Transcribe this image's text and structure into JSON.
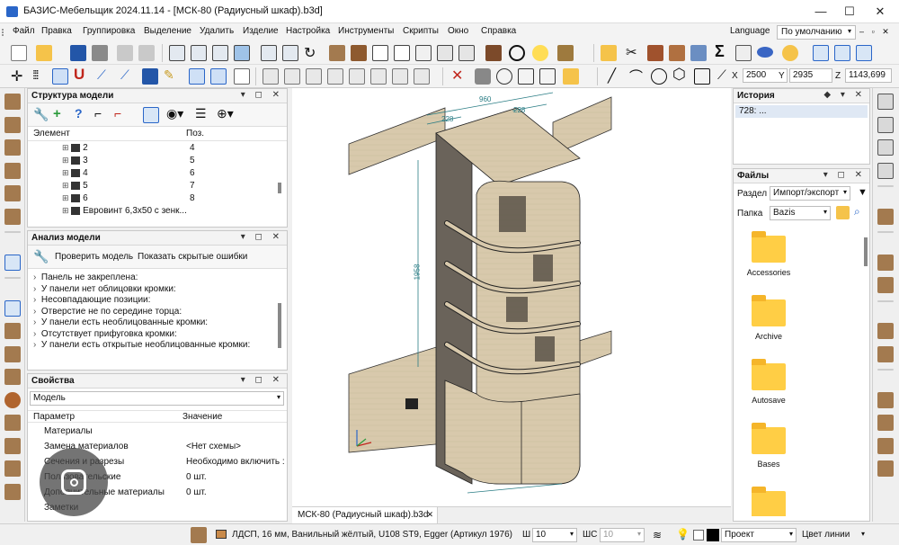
{
  "window": {
    "title": "БАЗИС-Мебельщик 2024.11.14 - [МСК-80 (Радиусный шкаф).b3d]",
    "minimize": "—",
    "maximize": "☐",
    "close": "✕"
  },
  "menu": [
    "Файл",
    "Правка",
    "Группировка",
    "Выделение",
    "Удалить",
    "Изделие",
    "Настройка",
    "Инструменты",
    "Скрипты",
    "Окно",
    "Справка"
  ],
  "menu_right": {
    "language": "Language",
    "default": "По умолчанию"
  },
  "coords": {
    "x_label": "X",
    "x": "2500",
    "y_label": "Y",
    "y": "2935",
    "z_label": "Z",
    "z": "1143,699"
  },
  "structure": {
    "title": "Структура модели",
    "col_element": "Элемент",
    "col_pos": "Поз.",
    "items": [
      {
        "name": "2",
        "pos": "4"
      },
      {
        "name": "3",
        "pos": "5"
      },
      {
        "name": "4",
        "pos": "6"
      },
      {
        "name": "5",
        "pos": "7"
      },
      {
        "name": "6",
        "pos": "8"
      },
      {
        "name": "Евровинт 6,3х50 с зенк...",
        "pos": ""
      }
    ]
  },
  "analysis": {
    "title": "Анализ модели",
    "check_button": "Проверить модель",
    "show_hidden_button": "Показать скрытые ошибки",
    "items": [
      "Панель не закреплена:",
      "У панели нет облицовки кромки:",
      "Несовпадающие позиции:",
      "Отверстие не по середине торца:",
      "У панели есть необлицованные кромки:",
      "Отсутствует прифуговка кромки:",
      "У панели есть открытые необлицованные кромки:"
    ]
  },
  "properties": {
    "title": "Свойства",
    "selector": "Модель",
    "col_param": "Параметр",
    "col_value": "Значение",
    "rows": [
      {
        "param": "Материалы",
        "value": ""
      },
      {
        "param": "Замена материалов",
        "value": "<Нет схемы>"
      },
      {
        "param": "Сечения и разрезы",
        "value": "Необходимо включить :"
      },
      {
        "param": "Пользовательские",
        "value": "0 шт."
      },
      {
        "param": "Дополнительные материалы",
        "value": "0 шт."
      },
      {
        "param": "Заметки",
        "value": ""
      }
    ]
  },
  "viewport": {
    "tab": "МСК-80 (Радиусный шкаф).b3d",
    "tab_close": "✕",
    "dim_width": "960",
    "dim_left": "228",
    "dim_right": "228",
    "dim_height": "1958"
  },
  "history": {
    "title": "История",
    "item": "728:  ..."
  },
  "files": {
    "title": "Файлы",
    "section_label": "Раздел",
    "section_value": "Импорт/экспорт",
    "folder_label": "Папка",
    "folder_value": "Bazis",
    "folders": [
      "Accessories",
      "Archive",
      "Autosave",
      "Bases",
      ""
    ]
  },
  "status": {
    "material": "ЛДСП, 16 мм, Ванильный жёлтый, U108 ST9, Egger (Артикул 1976)",
    "sh_label": "Ш",
    "sh_value": "10",
    "shc_label": "ШС",
    "shc_value": "10",
    "project": "Проект",
    "line_color": "Цвет линии"
  },
  "colors": {
    "accent": "#2a66c8",
    "wood": "#d8c9ac",
    "wood_dark": "#5a5248",
    "folder": "#ffce45",
    "dim_line": "#2a7d85"
  }
}
